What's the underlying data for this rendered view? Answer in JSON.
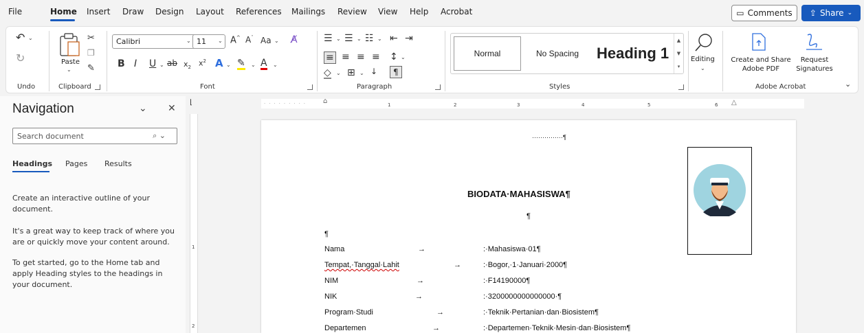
{
  "menu": {
    "tabs": [
      "File",
      "Home",
      "Insert",
      "Draw",
      "Design",
      "Layout",
      "References",
      "Mailings",
      "Review",
      "View",
      "Help",
      "Acrobat"
    ],
    "comments_label": "Comments",
    "share_label": "Share"
  },
  "ribbon": {
    "undo_label": "Undo",
    "clipboard_label": "Clipboard",
    "paste_label": "Paste",
    "font_label": "Font",
    "font_name": "Calibri",
    "font_size": "11",
    "paragraph_label": "Paragraph",
    "styles_label": "Styles",
    "styles": [
      "Normal",
      "No Spacing",
      "Heading 1"
    ],
    "editing_label": "Editing",
    "create_share_label": "Create and Share Adobe PDF",
    "request_sig_label": "Request Signatures",
    "adobe_group_label": "Adobe Acrobat",
    "accent_color": "#185abd"
  },
  "navigation": {
    "title": "Navigation",
    "search_placeholder": "Search document",
    "tabs": [
      "Headings",
      "Pages",
      "Results"
    ],
    "help_1": "Create an interactive outline of your document.",
    "help_2": "It's a great way to keep track of where you are or quickly move your content around.",
    "help_3": "To get started, go to the Home tab and apply Heading styles to the headings in your document."
  },
  "ruler": {
    "h_numbers": [
      "1",
      "2",
      "3",
      "4",
      "5",
      "6"
    ],
    "v_numbers": [
      "1",
      "2"
    ]
  },
  "document": {
    "top_mark": "···············¶",
    "title": "BIODATA·MAHASISWA¶",
    "pilcrow_center": "¶",
    "pilcrow_left": "¶",
    "rows": [
      {
        "label": "Nama",
        "value": ":·Mahasiswa·01¶"
      },
      {
        "label": "Tempat,·Tanggal·Lahit",
        "value": ":·Bogor,·1·Januari·2000¶"
      },
      {
        "label": "NIM",
        "value": ":·F14190000¶"
      },
      {
        "label": "NIK",
        "value": ":·3200000000000000·¶"
      },
      {
        "label": "Program·Studi",
        "value": ":·Teknik·Pertanian·dan·Biosistem¶"
      },
      {
        "label": "Departemen",
        "value": ":·Departemen·Teknik·Mesin·dan·Biosistem¶"
      }
    ],
    "arrow": "→"
  }
}
